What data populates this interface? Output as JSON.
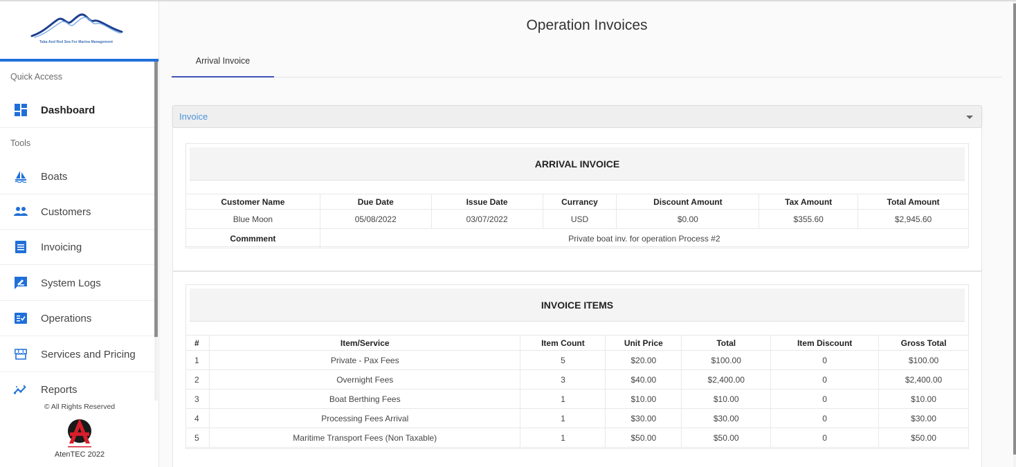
{
  "brand": {
    "logo_caption": "Taba And Red Sea For Marina Management",
    "accent_color": "#1f6fd9"
  },
  "sidebar": {
    "quick_access_label": "Quick Access",
    "tools_label": "Tools",
    "items": [
      {
        "label": "Dashboard",
        "icon": "dashboard-icon",
        "bold": true
      },
      {
        "label": "Boats",
        "icon": "sailboat-icon"
      },
      {
        "label": "Customers",
        "icon": "people-icon"
      },
      {
        "label": "Invoicing",
        "icon": "receipt-icon"
      },
      {
        "label": "System Logs",
        "icon": "edit-message-icon"
      },
      {
        "label": "Operations",
        "icon": "checklist-icon"
      },
      {
        "label": "Services and Pricing",
        "icon": "storefront-icon"
      },
      {
        "label": "Reports",
        "icon": "trending-icon"
      }
    ],
    "footer_rights": "© All Rights Reserved",
    "footer_company": "AtenTEC 2022"
  },
  "page": {
    "title": "Operation Invoices",
    "tabs": [
      {
        "label": "Arrival Invoice",
        "active": true
      }
    ],
    "select": {
      "value": "Invoice"
    }
  },
  "arrival_invoice": {
    "heading": "ARRIVAL INVOICE",
    "columns": [
      "Customer Name",
      "Due Date",
      "Issue Date",
      "Currancy",
      "Discount Amount",
      "Tax Amount",
      "Total Amount"
    ],
    "row": [
      "Blue Moon",
      "05/08/2022",
      "03/07/2022",
      "USD",
      "$0.00",
      "$355.60",
      "$2,945.60"
    ],
    "comment_label": "Commment",
    "comment": "Private boat inv. for operation Process #2"
  },
  "invoice_items": {
    "heading": "INVOICE ITEMS",
    "columns": [
      "#",
      "Item/Service",
      "Item Count",
      "Unit Price",
      "Total",
      "Item Discount",
      "Gross Total"
    ],
    "rows": [
      [
        "1",
        "Private - Pax Fees",
        "5",
        "$20.00",
        "$100.00",
        "0",
        "$100.00"
      ],
      [
        "2",
        "Overnight Fees",
        "3",
        "$40.00",
        "$2,400.00",
        "0",
        "$2,400.00"
      ],
      [
        "3",
        "Boat Berthing Fees",
        "1",
        "$10.00",
        "$10.00",
        "0",
        "$10.00"
      ],
      [
        "4",
        "Processing Fees Arrival",
        "1",
        "$30.00",
        "$30.00",
        "0",
        "$30.00"
      ],
      [
        "5",
        "Maritime Transport Fees (Non Taxable)",
        "1",
        "$50.00",
        "$50.00",
        "0",
        "$50.00"
      ]
    ]
  }
}
